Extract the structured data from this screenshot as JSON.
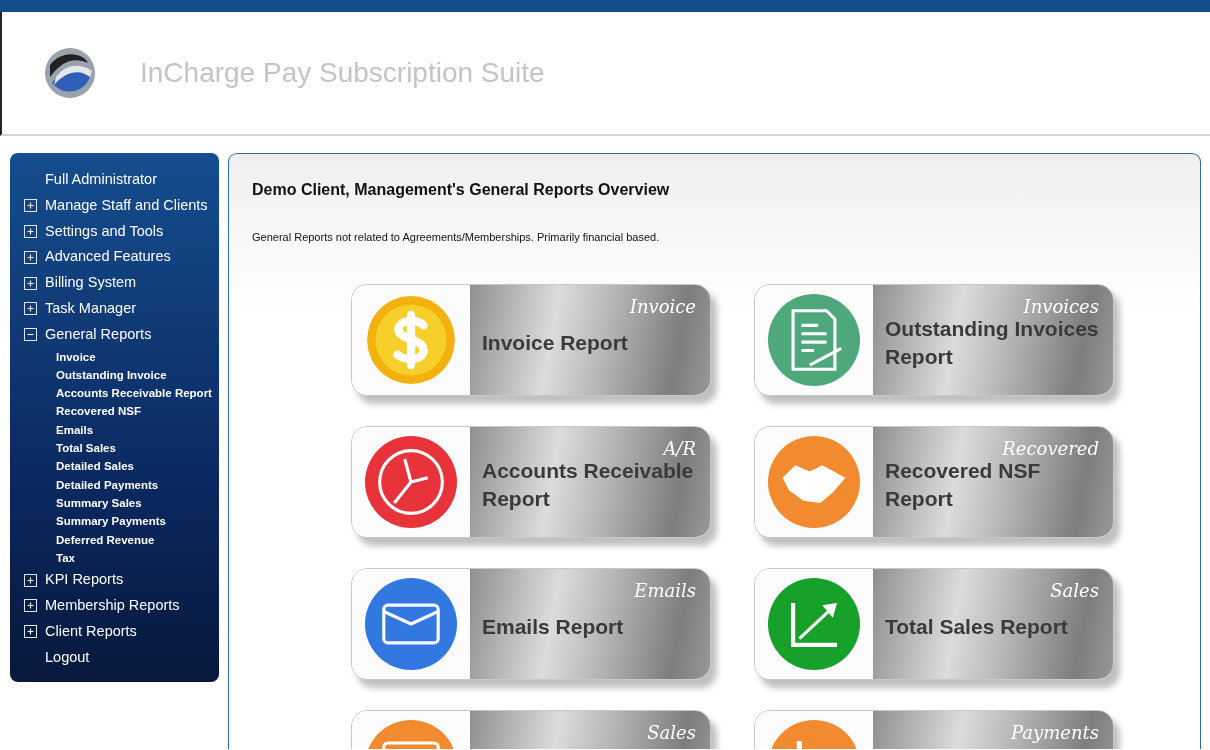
{
  "app_title": "InCharge Pay Subscription Suite",
  "sidebar": {
    "items": [
      {
        "kind": "link",
        "label": "Full Administrator"
      },
      {
        "kind": "group",
        "label": "Manage Staff and Clients",
        "expanded": false
      },
      {
        "kind": "group",
        "label": "Settings and Tools",
        "expanded": false
      },
      {
        "kind": "group",
        "label": "Advanced Features",
        "expanded": false
      },
      {
        "kind": "group",
        "label": "Billing System",
        "expanded": false
      },
      {
        "kind": "group",
        "label": "Task Manager",
        "expanded": false
      },
      {
        "kind": "group",
        "label": "General Reports",
        "expanded": true,
        "children": [
          {
            "label": "Invoice"
          },
          {
            "label": "Outstanding Invoice"
          },
          {
            "label": "Accounts Receivable Report"
          },
          {
            "label": "Recovered NSF"
          },
          {
            "label": "Emails"
          },
          {
            "label": "Total Sales"
          },
          {
            "label": "Detailed Sales"
          },
          {
            "label": "Detailed Payments"
          },
          {
            "label": "Summary Sales"
          },
          {
            "label": "Summary Payments"
          },
          {
            "label": "Deferred Revenue"
          },
          {
            "label": "Tax"
          }
        ]
      },
      {
        "kind": "group",
        "label": "KPI Reports",
        "expanded": false
      },
      {
        "kind": "group",
        "label": "Membership Reports",
        "expanded": false
      },
      {
        "kind": "group",
        "label": "Client Reports",
        "expanded": false
      },
      {
        "kind": "link",
        "label": "Logout"
      }
    ]
  },
  "main": {
    "heading": "Demo Client, Management's General Reports Overview",
    "description": "General Reports not related to Agreements/Memberships. Primarily financial based.",
    "tiles": [
      {
        "tag": "Invoice",
        "title": "Invoice Report",
        "color": "#f2b10c"
      },
      {
        "tag": "Invoices",
        "title": "Outstanding Invoices Report",
        "color": "#4fa87c"
      },
      {
        "tag": "A/R",
        "title": "Accounts Receivable Report",
        "color": "#e8333b"
      },
      {
        "tag": "Recovered",
        "title": "Recovered NSF Report",
        "color": "#f28a30"
      },
      {
        "tag": "Emails",
        "title": "Emails Report",
        "color": "#3377e0"
      },
      {
        "tag": "Sales",
        "title": "Total Sales Report",
        "color": "#17a02a"
      },
      {
        "tag": "Sales",
        "color": "#f28a30"
      },
      {
        "tag": "Payments",
        "color": "#f28a30"
      }
    ]
  }
}
